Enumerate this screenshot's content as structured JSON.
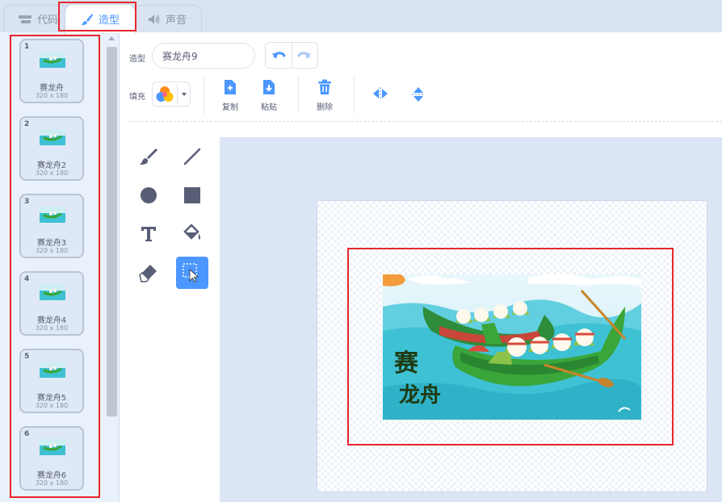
{
  "tabs": {
    "code": "代码",
    "costumes": "造型",
    "sounds": "声音"
  },
  "costumes": [
    {
      "num": "1",
      "name": "赛龙舟",
      "size": "320 x 180"
    },
    {
      "num": "2",
      "name": "赛龙舟2",
      "size": "320 x 180"
    },
    {
      "num": "3",
      "name": "赛龙舟3",
      "size": "320 x 180"
    },
    {
      "num": "4",
      "name": "赛龙舟4",
      "size": "320 x 180"
    },
    {
      "num": "5",
      "name": "赛龙舟5",
      "size": "320 x 180"
    },
    {
      "num": "6",
      "name": "赛龙舟6",
      "size": "320 x 180"
    }
  ],
  "editor": {
    "costume_label": "造型",
    "costume_name": "赛龙舟9",
    "fill_label": "填充",
    "copy_label": "复制",
    "paste_label": "粘贴",
    "delete_label": "删除"
  },
  "artwork": {
    "title_line1": "赛",
    "title_line2": "龙舟"
  },
  "colors": {
    "accent": "#4c97ff",
    "highlight": "#e8262b",
    "water": "#3ec1d3",
    "boat": "#3aa63a"
  }
}
